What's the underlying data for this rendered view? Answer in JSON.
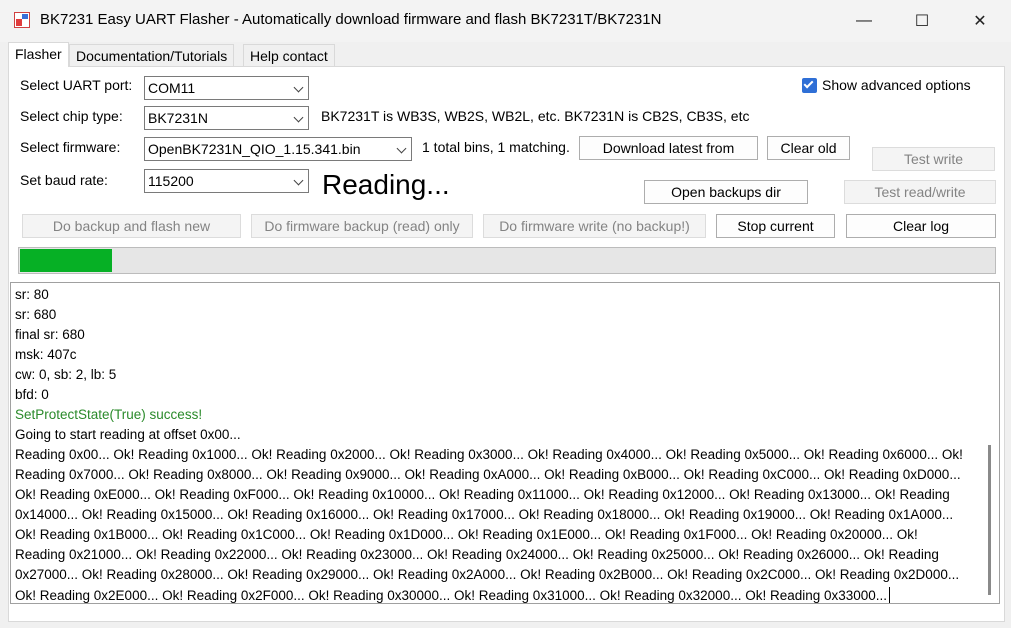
{
  "window": {
    "title": "BK7231 Easy UART Flasher - Automatically download firmware and flash BK7231T/BK7231N",
    "controls": {
      "minimize": "—",
      "maximize": "☐",
      "close": "✕"
    }
  },
  "tabs": [
    {
      "label": "Flasher"
    },
    {
      "label": "Documentation/Tutorials"
    },
    {
      "label": "Help contact"
    }
  ],
  "flasher": {
    "uart_label": "Select UART port:",
    "uart_value": "COM11",
    "chip_label": "Select chip type:",
    "chip_value": "BK7231N",
    "chip_info": "BK7231T is WB3S, WB2S, WB2L, etc. BK7231N is CB2S, CB3S, etc",
    "firmware_label": "Select firmware:",
    "firmware_value": "OpenBK7231N_QIO_1.15.341.bin",
    "bins_info": "1 total bins, 1 matching.",
    "baud_label": "Set baud rate:",
    "baud_value": "115200",
    "status": "Reading...",
    "advanced_label": "Show advanced options",
    "advanced_checked": true,
    "buttons": {
      "download_latest": "Download latest from",
      "clear_old": "Clear old",
      "test_write": "Test write",
      "open_backups": "Open backups dir",
      "test_read_write": "Test read/write",
      "backup_flash": "Do backup and flash new",
      "backup_read": "Do firmware backup (read) only",
      "firmware_write": "Do firmware write (no backup!)",
      "stop_current": "Stop current",
      "clear_log": "Clear log"
    },
    "progress_fraction": 0.094
  },
  "log": {
    "lines": [
      {
        "text": "sr: 80",
        "style": "normal"
      },
      {
        "text": "sr: 680",
        "style": "normal"
      },
      {
        "text": "final sr: 680",
        "style": "normal"
      },
      {
        "text": "msk: 407c",
        "style": "normal"
      },
      {
        "text": "cw: 0, sb: 2, lb: 5",
        "style": "normal"
      },
      {
        "text": "bfd: 0",
        "style": "normal"
      },
      {
        "text": "SetProtectState(True) success!",
        "style": "ok"
      },
      {
        "text": "Going to start reading at offset 0x00...",
        "style": "normal"
      },
      {
        "text": "Reading 0x00... Ok! Reading 0x1000... Ok! Reading 0x2000... Ok! Reading 0x3000... Ok! Reading 0x4000... Ok! Reading 0x5000... Ok! Reading 0x6000... Ok!",
        "style": "normal"
      },
      {
        "text": "Reading 0x7000... Ok! Reading 0x8000... Ok! Reading 0x9000... Ok! Reading 0xA000... Ok! Reading 0xB000... Ok! Reading 0xC000... Ok! Reading 0xD000...",
        "style": "normal"
      },
      {
        "text": "Ok! Reading 0xE000... Ok! Reading 0xF000... Ok! Reading 0x10000... Ok! Reading 0x11000... Ok! Reading 0x12000... Ok! Reading 0x13000... Ok! Reading",
        "style": "normal"
      },
      {
        "text": "0x14000... Ok! Reading 0x15000... Ok! Reading 0x16000... Ok! Reading 0x17000... Ok! Reading 0x18000... Ok! Reading 0x19000... Ok! Reading 0x1A000...",
        "style": "normal"
      },
      {
        "text": "Ok! Reading 0x1B000... Ok! Reading 0x1C000... Ok! Reading 0x1D000... Ok! Reading 0x1E000... Ok! Reading 0x1F000... Ok! Reading 0x20000... Ok!",
        "style": "normal"
      },
      {
        "text": "Reading 0x21000... Ok! Reading 0x22000... Ok! Reading 0x23000... Ok! Reading 0x24000... Ok! Reading 0x25000... Ok! Reading 0x26000... Ok! Reading",
        "style": "normal"
      },
      {
        "text": "0x27000... Ok! Reading 0x28000... Ok! Reading 0x29000... Ok! Reading 0x2A000... Ok! Reading 0x2B000... Ok! Reading 0x2C000... Ok! Reading 0x2D000...",
        "style": "normal"
      },
      {
        "text": "Ok! Reading 0x2E000... Ok! Reading 0x2F000... Ok! Reading 0x30000... Ok! Reading 0x31000... Ok! Reading 0x32000... Ok! Reading 0x33000...",
        "style": "normal"
      }
    ]
  }
}
